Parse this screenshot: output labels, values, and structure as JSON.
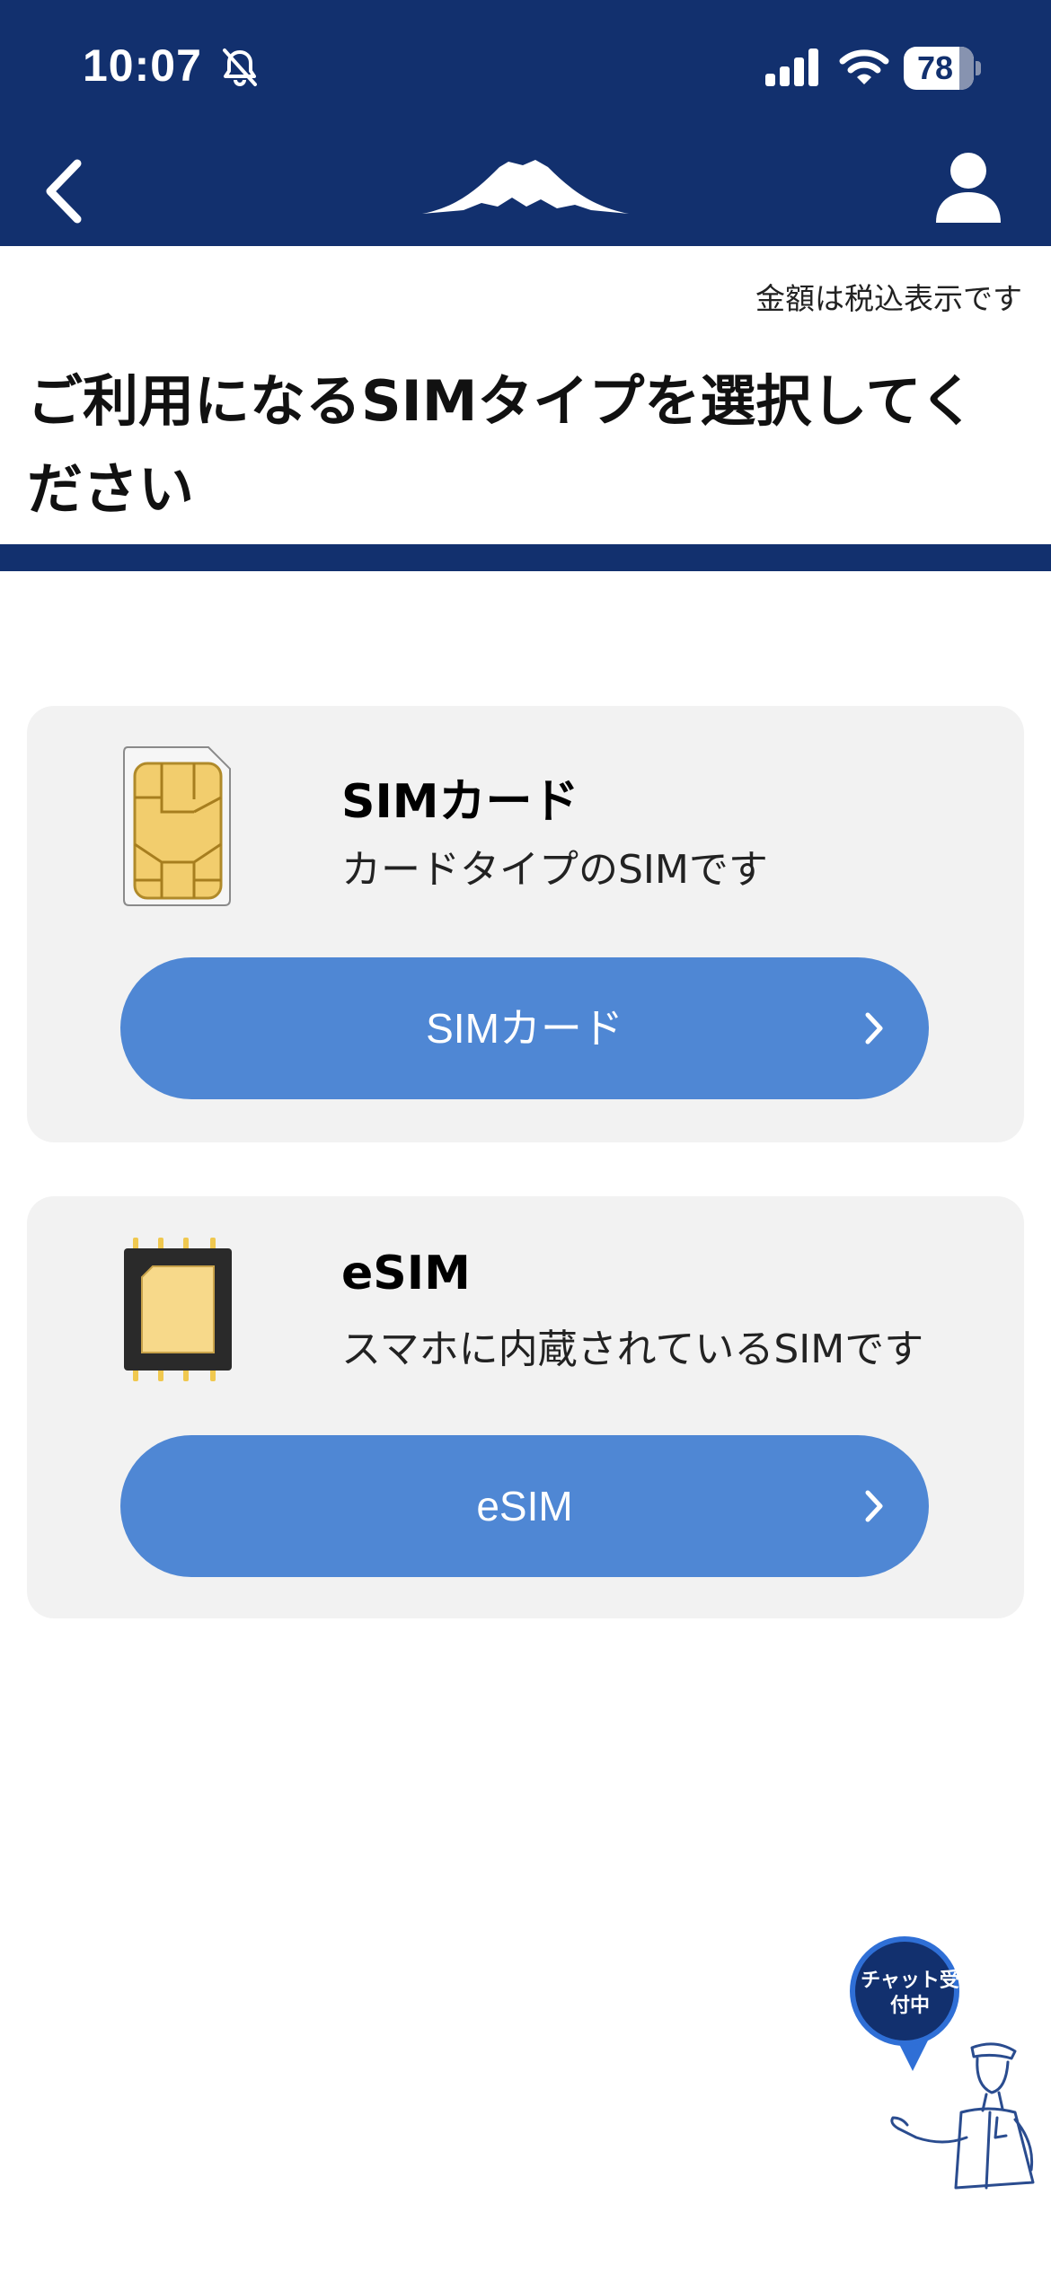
{
  "status_bar": {
    "time": "10:07",
    "battery": "78",
    "icons": [
      "bell-slash-icon",
      "cellular-signal-icon",
      "wifi-icon",
      "battery-icon"
    ]
  },
  "nav": {
    "back_icon": "chevron-left-icon",
    "logo_icon": "mount-fuji-logo",
    "user_icon": "user-icon"
  },
  "header": {
    "tax_note": "金額は税込表示です",
    "title": "ご利用になるSIMタイプを選択してください"
  },
  "options": [
    {
      "icon": "sim-card-icon",
      "title": "SIMカード",
      "description": "カードタイプのSIMです",
      "button_label": "SIMカード"
    },
    {
      "icon": "esim-chip-icon",
      "title": "eSIM",
      "description": "スマホに内蔵されているSIMです",
      "button_label": "eSIM"
    }
  ],
  "chat": {
    "label": "チャット受付中",
    "icon": "chat-agent-illustration"
  },
  "colors": {
    "brand_navy": "#12306e",
    "button_blue": "#4f87d4",
    "card_bg": "#f2f2f2",
    "chat_ring": "#2f6fd6"
  }
}
